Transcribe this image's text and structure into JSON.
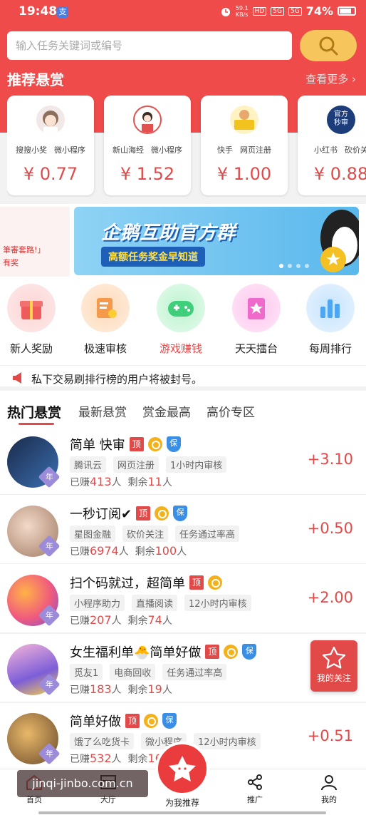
{
  "status_bar": {
    "time": "19:48",
    "app_badge": "支",
    "net_speed_top": "59.1",
    "net_speed_bottom": "KB/s",
    "hd_label": "HD",
    "signal1": "5G",
    "signal2": "5G",
    "battery": "74%"
  },
  "search": {
    "placeholder": "输入任务关键词或编号"
  },
  "recommended": {
    "title": "推荐悬赏",
    "see_more": "查看更多 ›",
    "cards": [
      {
        "tags": [
          "搜搜小奖",
          "微小程序"
        ],
        "price": "¥ 0.77"
      },
      {
        "tags": [
          "新山海经",
          "微小程序"
        ],
        "price": "¥ 1.52"
      },
      {
        "tags": [
          "快手",
          "网页注册"
        ],
        "price": "¥ 1.00"
      },
      {
        "tags": [
          "小红书",
          "砍价关"
        ],
        "price": "¥ 0.88"
      }
    ],
    "card4_logo": [
      "官方",
      "秒审"
    ]
  },
  "banner": {
    "left_line1": "筆審套路!」",
    "left_line2": "有奖",
    "title": "企鹅互助官方群",
    "subtitle": "高额任务奖金早知道"
  },
  "shortcuts": [
    {
      "label": "新人奖励",
      "color": "#ef5a5a"
    },
    {
      "label": "极速审核",
      "color": "#f49a4a"
    },
    {
      "label": "游戏赚钱",
      "color": "#3fcf7a"
    },
    {
      "label": "天天擂台",
      "color": "#f06acb"
    },
    {
      "label": "每周排行",
      "color": "#4fa6f0"
    }
  ],
  "notice": {
    "text": "私下交易刷排行榜的用户将被封号。"
  },
  "tabs": [
    "热门悬赏",
    "最新悬赏",
    "赏金最高",
    "高价专区"
  ],
  "tasks": [
    {
      "title": "简单 快审",
      "badges": [
        "顶",
        "coin",
        "保"
      ],
      "tags": [
        "腾讯云",
        "网页注册",
        "1小时内审核"
      ],
      "earned_prefix": "已赚",
      "earned": "413",
      "earned_suffix": "人",
      "remain_prefix": "剩余",
      "remain": "11",
      "remain_suffix": "人",
      "price": "+3.10",
      "year": "年"
    },
    {
      "title": "一秒订阅✔",
      "badges": [
        "顶",
        "coin",
        "保"
      ],
      "tags": [
        "星图金融",
        "砍价关注",
        "任务通过率高"
      ],
      "earned_prefix": "已赚",
      "earned": "6974",
      "earned_suffix": "人",
      "remain_prefix": "剩余",
      "remain": "100",
      "remain_suffix": "人",
      "price": "+0.50",
      "year": "年"
    },
    {
      "title": "扫个码就过，超简单",
      "badges": [
        "顶",
        "coin"
      ],
      "tags": [
        "小程序助力",
        "直播阅读",
        "12小时内审核"
      ],
      "earned_prefix": "已赚",
      "earned": "207",
      "earned_suffix": "人",
      "remain_prefix": "剩余",
      "remain": "74",
      "remain_suffix": "人",
      "price": "+2.00",
      "year": "年"
    },
    {
      "title": "女生福利单🐣简单好做",
      "badges": [
        "顶",
        "coin",
        "保"
      ],
      "tags": [
        "觅友1",
        "电商回收",
        "任务通过率高"
      ],
      "earned_prefix": "已赚",
      "earned": "183",
      "earned_suffix": "人",
      "remain_prefix": "剩余",
      "remain": "19",
      "remain_suffix": "人",
      "price": "",
      "year": "年"
    },
    {
      "title": "简单好做",
      "badges": [
        "顶",
        "coin",
        "保"
      ],
      "tags": [
        "饿了么吃货卡",
        "微小程序",
        "12小时内审核"
      ],
      "earned_prefix": "已赚",
      "earned": "532",
      "earned_suffix": "人",
      "remain_prefix": "剩余",
      "remain": "16",
      "remain_suffix": "",
      "price": "+0.51",
      "year": "年"
    }
  ],
  "follow_button": {
    "label": "我的关注"
  },
  "bottom_nav": {
    "home": "首页",
    "hall": "大厅",
    "center": "为我推荐",
    "share": "推广",
    "mine": "我的"
  },
  "watermark": "jinqi-jinbo.com.cn",
  "colors": {
    "primary_red": "#ef4b4b",
    "price_red": "#e24a4a",
    "search_button": "#f6c65d"
  }
}
